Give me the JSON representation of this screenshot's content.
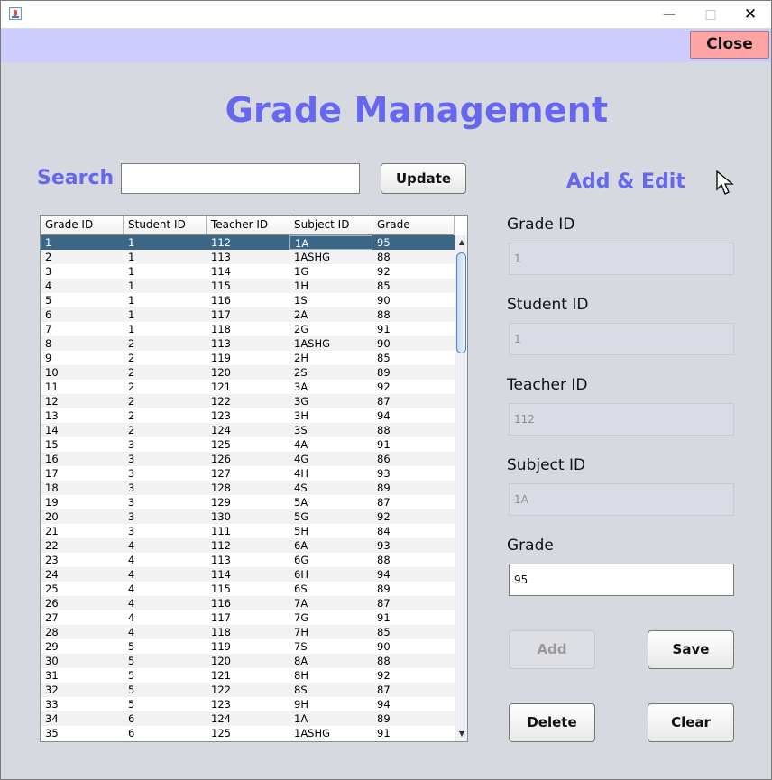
{
  "window": {
    "minimize_icon": "—",
    "maximize_icon": "□",
    "close_icon": "✕"
  },
  "toolbar": {
    "close_label": "Close"
  },
  "header": {
    "title": "Grade Management"
  },
  "search": {
    "label": "Search",
    "value": "",
    "update_label": "Update"
  },
  "table": {
    "columns": [
      "Grade ID",
      "Student ID",
      "Teacher ID",
      "Subject ID",
      "Grade"
    ],
    "selected_row": 0,
    "rows": [
      [
        "1",
        "1",
        "112",
        "1A",
        "95"
      ],
      [
        "2",
        "1",
        "113",
        "1ASHG",
        "88"
      ],
      [
        "3",
        "1",
        "114",
        "1G",
        "92"
      ],
      [
        "4",
        "1",
        "115",
        "1H",
        "85"
      ],
      [
        "5",
        "1",
        "116",
        "1S",
        "90"
      ],
      [
        "6",
        "1",
        "117",
        "2A",
        "88"
      ],
      [
        "7",
        "1",
        "118",
        "2G",
        "91"
      ],
      [
        "8",
        "2",
        "113",
        "1ASHG",
        "90"
      ],
      [
        "9",
        "2",
        "119",
        "2H",
        "85"
      ],
      [
        "10",
        "2",
        "120",
        "2S",
        "89"
      ],
      [
        "11",
        "2",
        "121",
        "3A",
        "92"
      ],
      [
        "12",
        "2",
        "122",
        "3G",
        "87"
      ],
      [
        "13",
        "2",
        "123",
        "3H",
        "94"
      ],
      [
        "14",
        "2",
        "124",
        "3S",
        "88"
      ],
      [
        "15",
        "3",
        "125",
        "4A",
        "91"
      ],
      [
        "16",
        "3",
        "126",
        "4G",
        "86"
      ],
      [
        "17",
        "3",
        "127",
        "4H",
        "93"
      ],
      [
        "18",
        "3",
        "128",
        "4S",
        "89"
      ],
      [
        "19",
        "3",
        "129",
        "5A",
        "87"
      ],
      [
        "20",
        "3",
        "130",
        "5G",
        "92"
      ],
      [
        "21",
        "3",
        "111",
        "5H",
        "84"
      ],
      [
        "22",
        "4",
        "112",
        "6A",
        "93"
      ],
      [
        "23",
        "4",
        "113",
        "6G",
        "88"
      ],
      [
        "24",
        "4",
        "114",
        "6H",
        "94"
      ],
      [
        "25",
        "4",
        "115",
        "6S",
        "89"
      ],
      [
        "26",
        "4",
        "116",
        "7A",
        "87"
      ],
      [
        "27",
        "4",
        "117",
        "7G",
        "91"
      ],
      [
        "28",
        "4",
        "118",
        "7H",
        "85"
      ],
      [
        "29",
        "5",
        "119",
        "7S",
        "90"
      ],
      [
        "30",
        "5",
        "120",
        "8A",
        "88"
      ],
      [
        "31",
        "5",
        "121",
        "8H",
        "92"
      ],
      [
        "32",
        "5",
        "122",
        "8S",
        "87"
      ],
      [
        "33",
        "5",
        "123",
        "9H",
        "94"
      ],
      [
        "34",
        "6",
        "124",
        "1A",
        "89"
      ],
      [
        "35",
        "6",
        "125",
        "1ASHG",
        "91"
      ]
    ]
  },
  "form": {
    "title": "Add & Edit",
    "grade_id_label": "Grade ID",
    "grade_id_value": "1",
    "student_id_label": "Student ID",
    "student_id_value": "1",
    "teacher_id_label": "Teacher ID",
    "teacher_id_value": "112",
    "subject_id_label": "Subject ID",
    "subject_id_value": "1A",
    "grade_label": "Grade",
    "grade_value": "95",
    "add_label": "Add",
    "save_label": "Save",
    "delete_label": "Delete",
    "clear_label": "Clear"
  },
  "colors": {
    "accent": "#6666ee",
    "topbar": "#ccccff",
    "close_button": "#ffa4a4",
    "selection": "#3c6686"
  }
}
